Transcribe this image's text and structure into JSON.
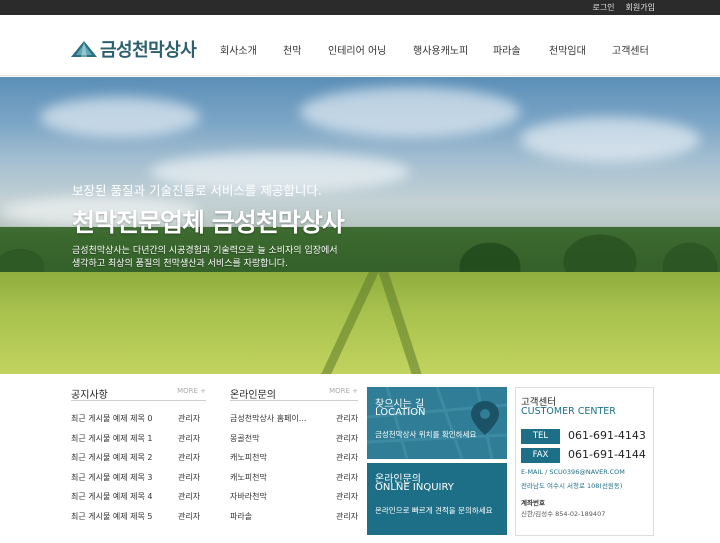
{
  "topbar": {
    "login": "로그인",
    "signup": "회원가입"
  },
  "logo": {
    "name": "금성천막상사"
  },
  "nav": [
    "회사소개",
    "천막",
    "인테리어 어닝",
    "행사용캐노피",
    "파라솔",
    "천막임대",
    "고객센터"
  ],
  "hero": {
    "subtitle": "보장된 품질과 기술진들로 서비스를 제공합니다.",
    "title": "천막전문업체 금성천막상사",
    "desc1": "금성천막상사는 다년간의 시공경험과 기술력으로 늘 소비자의 입장에서",
    "desc2": "생각하고 최상의 품질의 천막생산과 서비스를 자랑합니다."
  },
  "notice": {
    "title": "공지사항",
    "more": "MORE +",
    "rows": [
      {
        "subject": "최근 게시물 예제 제목 0",
        "author": "관리자"
      },
      {
        "subject": "최근 게시물 예제 제목 1",
        "author": "관리자"
      },
      {
        "subject": "최근 게시물 예제 제목 2",
        "author": "관리자"
      },
      {
        "subject": "최근 게시물 예제 제목 3",
        "author": "관리자"
      },
      {
        "subject": "최근 게시물 예제 제목 4",
        "author": "관리자"
      },
      {
        "subject": "최근 게시물 예제 제목 5",
        "author": "관리자"
      }
    ]
  },
  "inquiry_board": {
    "title": "온라인문의",
    "more": "MORE +",
    "rows": [
      {
        "subject": "금성천막상사 홈페이...",
        "author": "관리자"
      },
      {
        "subject": "몽골천막",
        "author": "관리자"
      },
      {
        "subject": "캐노피천막",
        "author": "관리자"
      },
      {
        "subject": "캐노피천막",
        "author": "관리자"
      },
      {
        "subject": "자바라천막",
        "author": "관리자"
      },
      {
        "subject": "파라솔",
        "author": "관리자"
      }
    ]
  },
  "location": {
    "title": "찾으시는 길",
    "title_en": "LOCATION",
    "desc": "금성천막상사 위치를 확인하세요"
  },
  "online": {
    "title": "온라인문의",
    "title_en": "ONLNE INQUIRY",
    "desc": "온라인으로 빠르게 견적을 문의하세요"
  },
  "customer": {
    "title": "고객센터",
    "title_en": "CUSTOMER CENTER",
    "tel_label": "TEL",
    "tel": "061-691-4143",
    "fax_label": "FAX",
    "fax": "061-691-4144",
    "email": "E-MAIL / SCU0396@NAVER.COM",
    "address": "전라남도 여수시 서청로 108(선원동)",
    "account_label": "계좌번호",
    "account": "신한/김성수 854-02-189407"
  },
  "colors": {
    "accent": "#1d6f87",
    "brand": "#2c5f6f"
  }
}
